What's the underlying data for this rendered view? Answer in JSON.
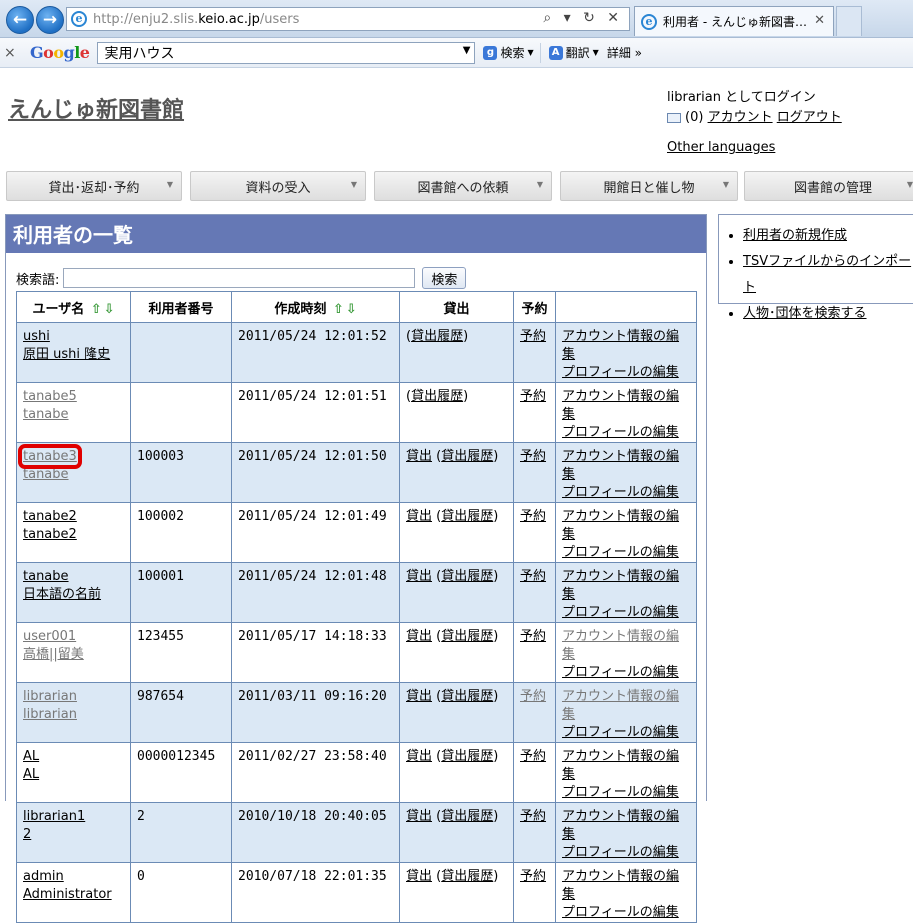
{
  "browser": {
    "url_prefix": "http://enju2.slis.",
    "url_domain": "keio.ac.jp",
    "url_path": "/users",
    "tab_title": "利用者 - えんじゅ新図書…",
    "addr_tools": "⌕ ▾ ↻ ✕"
  },
  "toolbar": {
    "google_query": "実用ハウス",
    "search_label": "検索",
    "translate_label": "翻訳",
    "details_label": "詳細 »"
  },
  "site": {
    "title": "えんじゅ新図書館",
    "login_text": "librarian としてログイン",
    "mail_count": "(0)",
    "account_link": "アカウント",
    "logout_link": "ログアウト",
    "other_languages": "Other languages"
  },
  "menu": [
    {
      "label": "貸出･返却･予約"
    },
    {
      "label": "資料の受入"
    },
    {
      "label": "図書館への依頼"
    },
    {
      "label": "開館日と催し物"
    },
    {
      "label": "図書館の管理"
    }
  ],
  "main": {
    "heading": "利用者の一覧",
    "search_label": "検索語:",
    "search_value": "",
    "search_button": "検索"
  },
  "table": {
    "headers": {
      "username": "ユーザ名",
      "number": "利用者番号",
      "created": "作成時刻",
      "checkout": "貸出",
      "reserve": "予約"
    },
    "rows": [
      {
        "username": "ushi",
        "full_name": "原田 ushi 隆史",
        "number": "",
        "created": "2011/05/24 12:01:52",
        "checkout": "",
        "history": "貸出履歴",
        "reserve": "予約",
        "account_edit": "アカウント情報の編集",
        "profile_edit": "プロフィールの編集",
        "muted": false
      },
      {
        "username": "tanabe5",
        "full_name": "tanabe",
        "number": "",
        "created": "2011/05/24 12:01:51",
        "checkout": "",
        "history": "貸出履歴",
        "reserve": "予約",
        "account_edit": "アカウント情報の編集",
        "profile_edit": "プロフィールの編集",
        "muted": true
      },
      {
        "username": "tanabe3",
        "full_name": "tanabe",
        "number": "100003",
        "created": "2011/05/24 12:01:50",
        "checkout": "貸出",
        "history": "貸出履歴",
        "reserve": "予約",
        "account_edit": "アカウント情報の編集",
        "profile_edit": "プロフィールの編集",
        "muted": true
      },
      {
        "username": "tanabe2",
        "full_name": "tanabe2",
        "number": "100002",
        "created": "2011/05/24 12:01:49",
        "checkout": "貸出",
        "history": "貸出履歴",
        "reserve": "予約",
        "account_edit": "アカウント情報の編集",
        "profile_edit": "プロフィールの編集",
        "muted": false
      },
      {
        "username": "tanabe",
        "full_name": "日本語の名前",
        "number": "100001",
        "created": "2011/05/24 12:01:48",
        "checkout": "貸出",
        "history": "貸出履歴",
        "reserve": "予約",
        "account_edit": "アカウント情報の編集",
        "profile_edit": "プロフィールの編集",
        "muted": false
      },
      {
        "username": "user001",
        "full_name": "高橋||留美",
        "number": "123455",
        "created": "2011/05/17 14:18:33",
        "checkout": "貸出",
        "history": "貸出履歴",
        "reserve": "予約",
        "account_edit": "アカウント情報の編集",
        "profile_edit": "プロフィールの編集",
        "muted": true
      },
      {
        "username": "librarian",
        "full_name": "librarian",
        "number": "987654",
        "created": "2011/03/11 09:16:20",
        "checkout": "貸出",
        "history": "貸出履歴",
        "reserve": "予約",
        "account_edit": "アカウント情報の編集",
        "profile_edit": "プロフィールの編集",
        "muted": true
      },
      {
        "username": "AL",
        "full_name": "AL",
        "number": "0000012345",
        "created": "2011/02/27 23:58:40",
        "checkout": "貸出",
        "history": "貸出履歴",
        "reserve": "予約",
        "account_edit": "アカウント情報の編集",
        "profile_edit": "プロフィールの編集",
        "muted": false
      },
      {
        "username": "librarian1",
        "full_name": "2",
        "number": "2",
        "created": "2010/10/18 20:40:05",
        "checkout": "貸出",
        "history": "貸出履歴",
        "reserve": "予約",
        "account_edit": "アカウント情報の編集",
        "profile_edit": "プロフィールの編集",
        "muted": false
      },
      {
        "username": "admin",
        "full_name": "Administrator",
        "number": "0",
        "created": "2010/07/18 22:01:35",
        "checkout": "貸出",
        "history": "貸出履歴",
        "reserve": "予約",
        "account_edit": "アカウント情報の編集",
        "profile_edit": "プロフィールの編集",
        "muted": false
      }
    ]
  },
  "sidebar": {
    "links": [
      {
        "label": "利用者の新規作成"
      },
      {
        "label": "TSVファイルからのインポート"
      },
      {
        "label": "人物･団体を検索する"
      }
    ]
  },
  "colors": {
    "panel_header": "#6578b5",
    "row_alt": "#dbe8f5",
    "highlight": "#e00000"
  }
}
